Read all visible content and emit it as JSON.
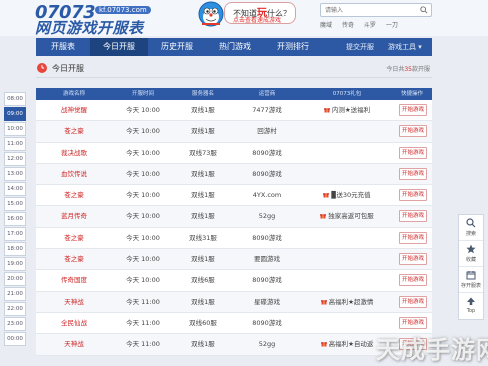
{
  "logo": {
    "number": "07073",
    "url": "kf.07073.com",
    "title": "网页游戏开服表"
  },
  "bubble": {
    "pre": "不知道",
    "hot": "玩",
    "post": "什么？",
    "sub": "点击查看速成游戏"
  },
  "search": {
    "placeholder": "请输入",
    "hotwords": [
      "魔域",
      "传奇",
      "斗罗",
      "一刀"
    ]
  },
  "nav": {
    "items": [
      "开服表",
      "今日开服",
      "历史开服",
      "热门游戏",
      "开测排行"
    ],
    "right": [
      "提交开服",
      "游戏工具 ▾"
    ]
  },
  "section": {
    "title": "今日开服",
    "count_pre": "今日共",
    "count": "35",
    "count_post": "款开服"
  },
  "times": [
    "08:00",
    "09:00",
    "10:00",
    "11:00",
    "12:00",
    "13:00",
    "14:00",
    "15:00",
    "16:00",
    "17:00",
    "18:00",
    "19:00",
    "20:00",
    "21:00",
    "22:00",
    "23:00",
    "00:00"
  ],
  "table": {
    "headers": [
      "游戏名称",
      "开服时间",
      "服务器名",
      "运营商",
      "07073礼包",
      "快捷操作"
    ],
    "rows": [
      {
        "name": "战神觉醒",
        "time": "今天 10:00",
        "server": "双线1服",
        "op": "7477游戏",
        "gift": "内测★送福利",
        "btn": "开始游戏"
      },
      {
        "name": "苍之豪",
        "time": "今天 10:00",
        "server": "双线1服",
        "op": "回游村",
        "gift": "",
        "btn": "开始游戏"
      },
      {
        "name": "裁决战歌",
        "time": "今天 10:00",
        "server": "双线73服",
        "op": "8090游戏",
        "gift": "",
        "btn": "开始游戏"
      },
      {
        "name": "血饮传说",
        "time": "今天 10:00",
        "server": "双线1服",
        "op": "8090游戏",
        "gift": "",
        "btn": "开始游戏"
      },
      {
        "name": "苍之豪",
        "time": "今天 10:00",
        "server": "双线1服",
        "op": "4YX.com",
        "gift": "▉送30元充值",
        "btn": "开始游戏"
      },
      {
        "name": "蓝月传奇",
        "time": "今天 10:00",
        "server": "双线1服",
        "op": "52gg",
        "gift": "独家高返可包服",
        "btn": "开始游戏"
      },
      {
        "name": "苍之豪",
        "time": "今天 10:00",
        "server": "双线31服",
        "op": "8090游戏",
        "gift": "",
        "btn": "开始游戏"
      },
      {
        "name": "苍之豪",
        "time": "今天 10:00",
        "server": "双线1服",
        "op": "要圆游戏",
        "gift": "",
        "btn": "开始游戏"
      },
      {
        "name": "传奇国度",
        "time": "今天 10:00",
        "server": "双线6服",
        "op": "8090游戏",
        "gift": "",
        "btn": "开始游戏"
      },
      {
        "name": "天神战",
        "time": "今天 11:00",
        "server": "双线1服",
        "op": "星碟游戏",
        "gift": "高福利★超激情",
        "btn": "开始游戏"
      },
      {
        "name": "全民仙战",
        "time": "今天 11:00",
        "server": "双线60服",
        "op": "8090游戏",
        "gift": "",
        "btn": "开始游戏"
      },
      {
        "name": "天神战",
        "time": "今天 11:00",
        "server": "双线1服",
        "op": "52gg",
        "gift": "高福利★自动返",
        "btn": "开始游戏"
      }
    ]
  },
  "tools": [
    {
      "icon": "search-icon",
      "label": "搜索"
    },
    {
      "icon": "star-icon",
      "label": "收藏"
    },
    {
      "icon": "calendar-icon",
      "label": "存开服表"
    },
    {
      "icon": "top-icon",
      "label": "Top"
    }
  ],
  "watermark": "天成手游网",
  "colors": {
    "nav": "#2c58a4",
    "accent": "#d02626"
  }
}
